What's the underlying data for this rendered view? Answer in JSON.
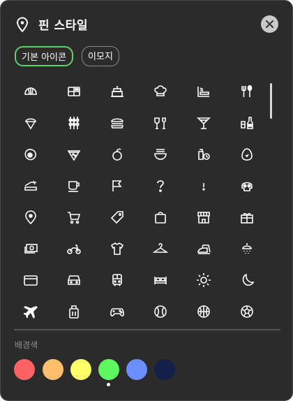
{
  "dialog": {
    "title": "핀 스타일"
  },
  "tabs": [
    {
      "label": "기본 아이콘",
      "selected": true
    },
    {
      "label": "이모지",
      "selected": false
    }
  ],
  "icons": [
    "croissant-icon",
    "cash-register-icon",
    "cake-icon",
    "chef-hat-icon",
    "teppanyaki-icon",
    "fork-spoon-icon",
    "ice-cream-icon",
    "skewer-icon",
    "burger-icon",
    "glass-bottle-icon",
    "cocktail-icon",
    "beer-bottle-icon",
    "fried-egg-icon",
    "pizza-slice-icon",
    "apple-icon",
    "noodle-bowl-icon",
    "grocery-clock-icon",
    "egg-icon",
    "sandwich-icon",
    "coffee-cup-icon",
    "flag-icon",
    "question-icon",
    "exclamation-icon",
    "skull-icon",
    "location-pin-icon",
    "shopping-cart-icon",
    "price-tag-icon",
    "shopping-bag-icon",
    "store-icon",
    "gift-box-icon",
    "money-icon",
    "motorcycle-icon",
    "t-shirt-icon",
    "hanger-icon",
    "iron-icon",
    "shower-icon",
    "credit-card-icon",
    "car-icon",
    "train-icon",
    "bed-icon",
    "sun-icon",
    "moon-icon",
    "airplane-icon",
    "suitcase-icon",
    "game-controller-icon",
    "baseball-icon",
    "basketball-icon",
    "soccer-ball-icon"
  ],
  "background": {
    "label": "배경색",
    "colors": [
      "#ff6262",
      "#ffbf6a",
      "#ffff6a",
      "#5ef95e",
      "#6a8eff",
      "#15204a"
    ],
    "selected_index": 4
  }
}
